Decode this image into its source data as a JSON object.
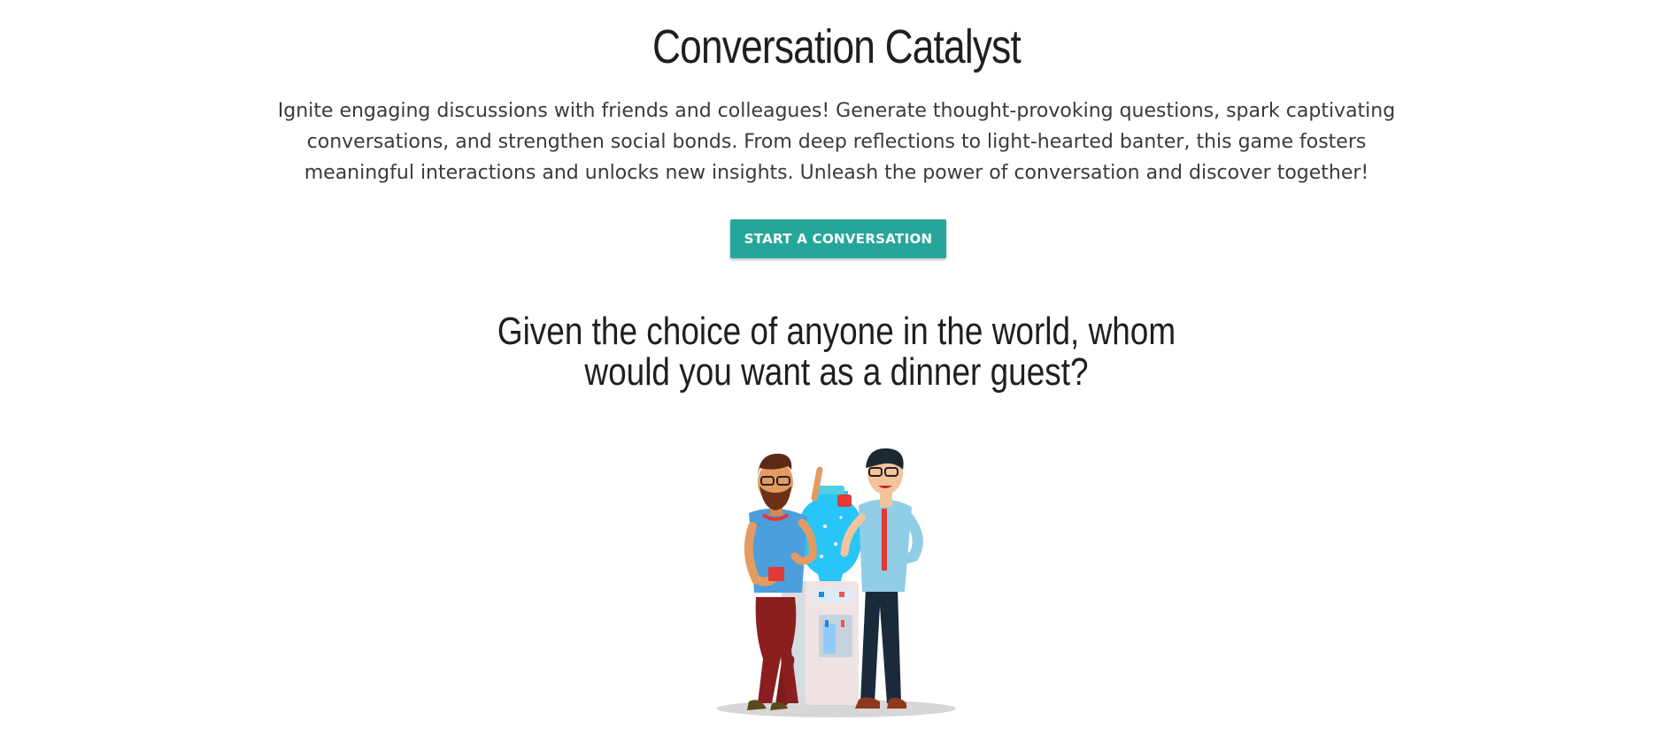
{
  "header": {
    "title": "Conversation Catalyst",
    "description": "Ignite engaging discussions with friends and colleagues! Generate thought-provoking questions, spark captivating conversations, and strengthen social bonds. From deep reflections to light-hearted banter, this game fosters meaningful interactions and unlocks new insights. Unleash the power of conversation and discover together!"
  },
  "actions": {
    "start_label": "START A CONVERSATION"
  },
  "question": {
    "text": "Given the choice of anyone in the world, whom would you want as a dinner guest?"
  },
  "illustration": {
    "icon": "water-cooler-conversation-illustration"
  },
  "colors": {
    "accent": "#26a69a",
    "text": "#1f1f1f"
  }
}
